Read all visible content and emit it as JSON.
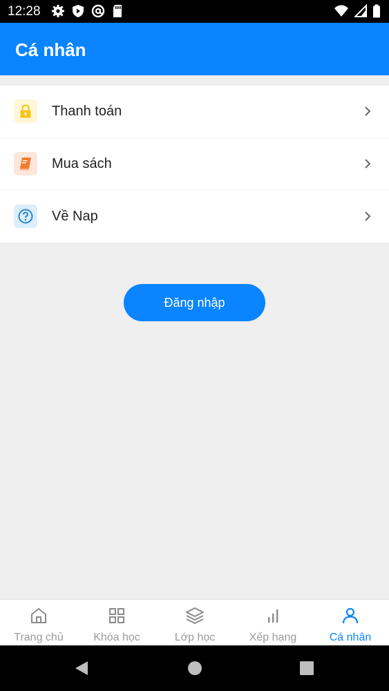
{
  "status_bar": {
    "time": "12:28",
    "left_icons": [
      "gear-icon",
      "shield-icon",
      "at-sign-icon",
      "sd-card-icon"
    ],
    "right_icons": [
      "wifi-icon",
      "cell-signal-icon",
      "battery-icon"
    ]
  },
  "app_bar": {
    "title": "Cá nhân",
    "color": "#0a84ff"
  },
  "menu": {
    "items": [
      {
        "label": "Thanh toán",
        "icon": "lock-icon",
        "icon_color": "#f5c518"
      },
      {
        "label": "Mua sách",
        "icon": "book-icon",
        "icon_color": "#f07d2e"
      },
      {
        "label": "Về Nap",
        "icon": "help-circle-icon",
        "icon_color": "#2a86c8"
      }
    ]
  },
  "login": {
    "label": "Đăng nhập"
  },
  "bottom_nav": {
    "items": [
      {
        "label": "Trang chủ",
        "icon": "home-icon",
        "active": false
      },
      {
        "label": "Khóa học",
        "icon": "grid-icon",
        "active": false
      },
      {
        "label": "Lớp học",
        "icon": "layers-icon",
        "active": false
      },
      {
        "label": "Xếp hạng",
        "icon": "bar-chart-icon",
        "active": false
      },
      {
        "label": "Cá nhân",
        "icon": "user-icon",
        "active": true
      }
    ]
  },
  "system_nav": {
    "buttons": [
      "back-icon",
      "home-circle-icon",
      "recents-square-icon"
    ]
  }
}
